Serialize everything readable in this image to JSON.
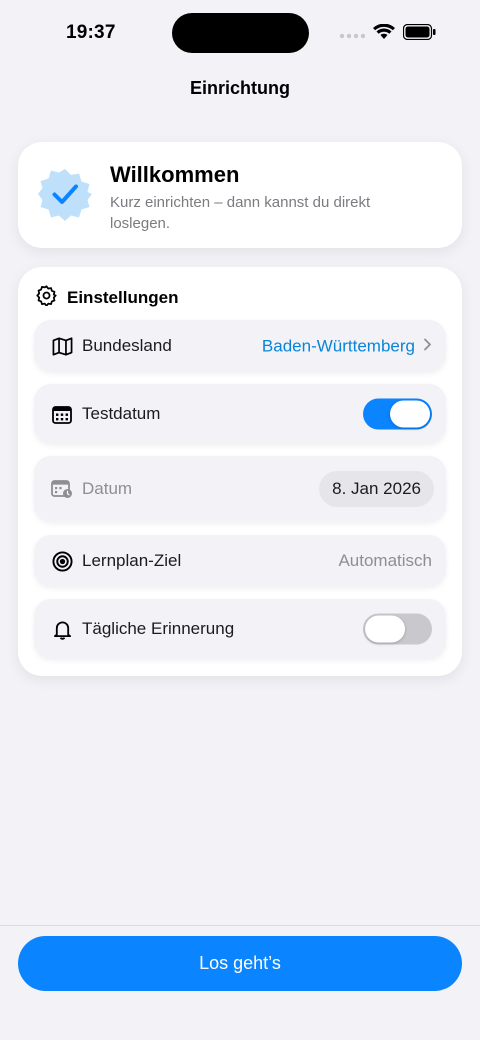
{
  "status_bar": {
    "time": "19:37"
  },
  "nav": {
    "title": "Einrichtung"
  },
  "welcome": {
    "title": "Willkommen",
    "subtitle": "Kurz einrichten – dann kannst du direkt loslegen."
  },
  "settings": {
    "title": "Einstellungen",
    "rows": {
      "state": {
        "label": "Bundesland",
        "value": "Baden-Württemberg"
      },
      "test_date": {
        "label": "Testdatum",
        "toggle_on": true
      },
      "date": {
        "label": "Datum",
        "value": "8. Jan 2026"
      },
      "goal": {
        "label": "Lernplan-Ziel",
        "value": "Automatisch"
      },
      "reminder": {
        "label": "Tägliche Erinnerung",
        "toggle_on": false
      }
    }
  },
  "cta": {
    "label": "Los geht’s"
  },
  "colors": {
    "accent": "#0a84ff",
    "link": "#0a84d8",
    "background": "#f2f2f7"
  }
}
